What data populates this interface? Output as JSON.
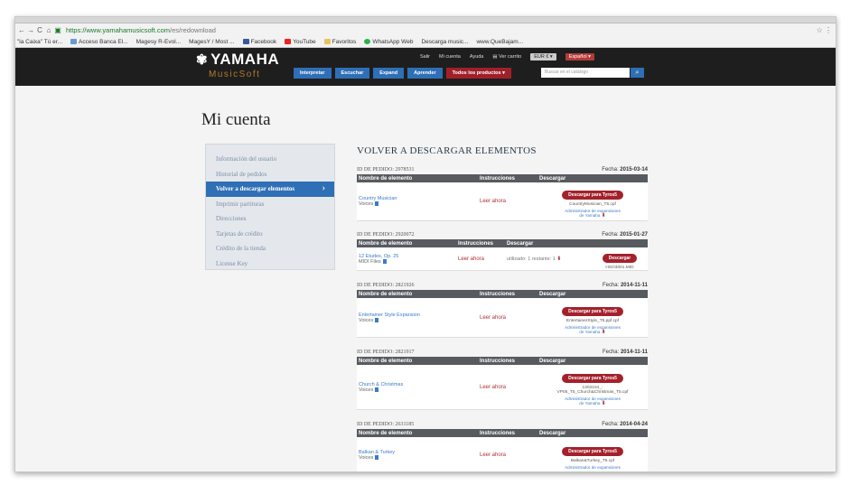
{
  "browser": {
    "url_secure": "https://www.yamahamusicsoft.com",
    "url_path": "/es/redownload",
    "bookmarks": [
      "\"la Caixa\" Tú er...",
      "Acceso Banca El...",
      "Magesy R-Evol...",
      "MagesY / Most ...",
      "Facebook",
      "YouTube",
      "Favoritos",
      "WhatsApp Web",
      "Descarga music...",
      "www.QueBajam..."
    ]
  },
  "header": {
    "logo": "YAMAHA",
    "logo_mark": "✾",
    "subbrand": "MusicSoft",
    "top_links": [
      "Salir",
      "Mi cuenta",
      "Ayuda",
      "Ver carrito"
    ],
    "currency": "EUR €",
    "language": "Español",
    "nav": [
      "Interpretar",
      "Escuchar",
      "Expand",
      "Aprender"
    ],
    "nav_all": "Todos los productos",
    "search_placeholder": "Buscar en el catálogo",
    "colors": {
      "header_bg": "#1e1e1e",
      "nav_blue": "#2f6fb6",
      "accent_red": "#a3212b",
      "subbrand": "#b57a2b"
    }
  },
  "page_title": "Mi cuenta",
  "sidebar": {
    "items": [
      "Información del usuario",
      "Historial de pedidos",
      "Volver a descargar elementos",
      "Imprimir partituras",
      "Direcciones",
      "Tarjetas de crédito",
      "Crédito de la tienda",
      "License Key"
    ],
    "active_index": 2
  },
  "main": {
    "title": "VOLVER A DESCARGAR ELEMENTOS",
    "col_item": "Nombre de elemento",
    "col_instructions": "Instrucciones",
    "col_download": "Descargar",
    "read_now": "Leer ahora",
    "download_btn": "Descargar para Tyros5",
    "download_btn_short": "Descargar",
    "admin_link_1": "Administrador de expansiones",
    "admin_link_2": "de Yamaha",
    "orders": [
      {
        "id": "ID DE PEDIDO: 2978531",
        "date_label": "Fecha:",
        "date": "2015-03-14",
        "item": "Country Musician",
        "type": "Voices",
        "file": "CountryMusician_T5.cpf"
      },
      {
        "id": "ID DE PEDIDO: 2920072",
        "date_label": "Fecha:",
        "date": "2015-01-27",
        "item": "12 Etudes, Op. 25",
        "type": "MIDI Files",
        "used": "utilizado: 1 restante: 1",
        "file": "HSO3001.MID"
      },
      {
        "id": "ID DE PEDIDO: 2821926",
        "date_label": "Fecha:",
        "date": "2014-11-11",
        "item": "Entertainer Style Expansion",
        "type": "Voices",
        "file": "EntertainerStyle_T5.ppf.cpf"
      },
      {
        "id": "ID DE PEDIDO: 2821917",
        "date_label": "Fecha:",
        "date": "2014-11-11",
        "item": "Church & Christmas",
        "type": "Voices",
        "file": "1303104_-VP05_T5_Church&Christmas_T5.cpf"
      },
      {
        "id": "ID DE PEDIDO: 2631185",
        "date_label": "Fecha:",
        "date": "2014-04-24",
        "item": "Balkan & Turkey",
        "type": "Voices",
        "file": "Balkan&Turkey_T5.cpf"
      }
    ]
  }
}
